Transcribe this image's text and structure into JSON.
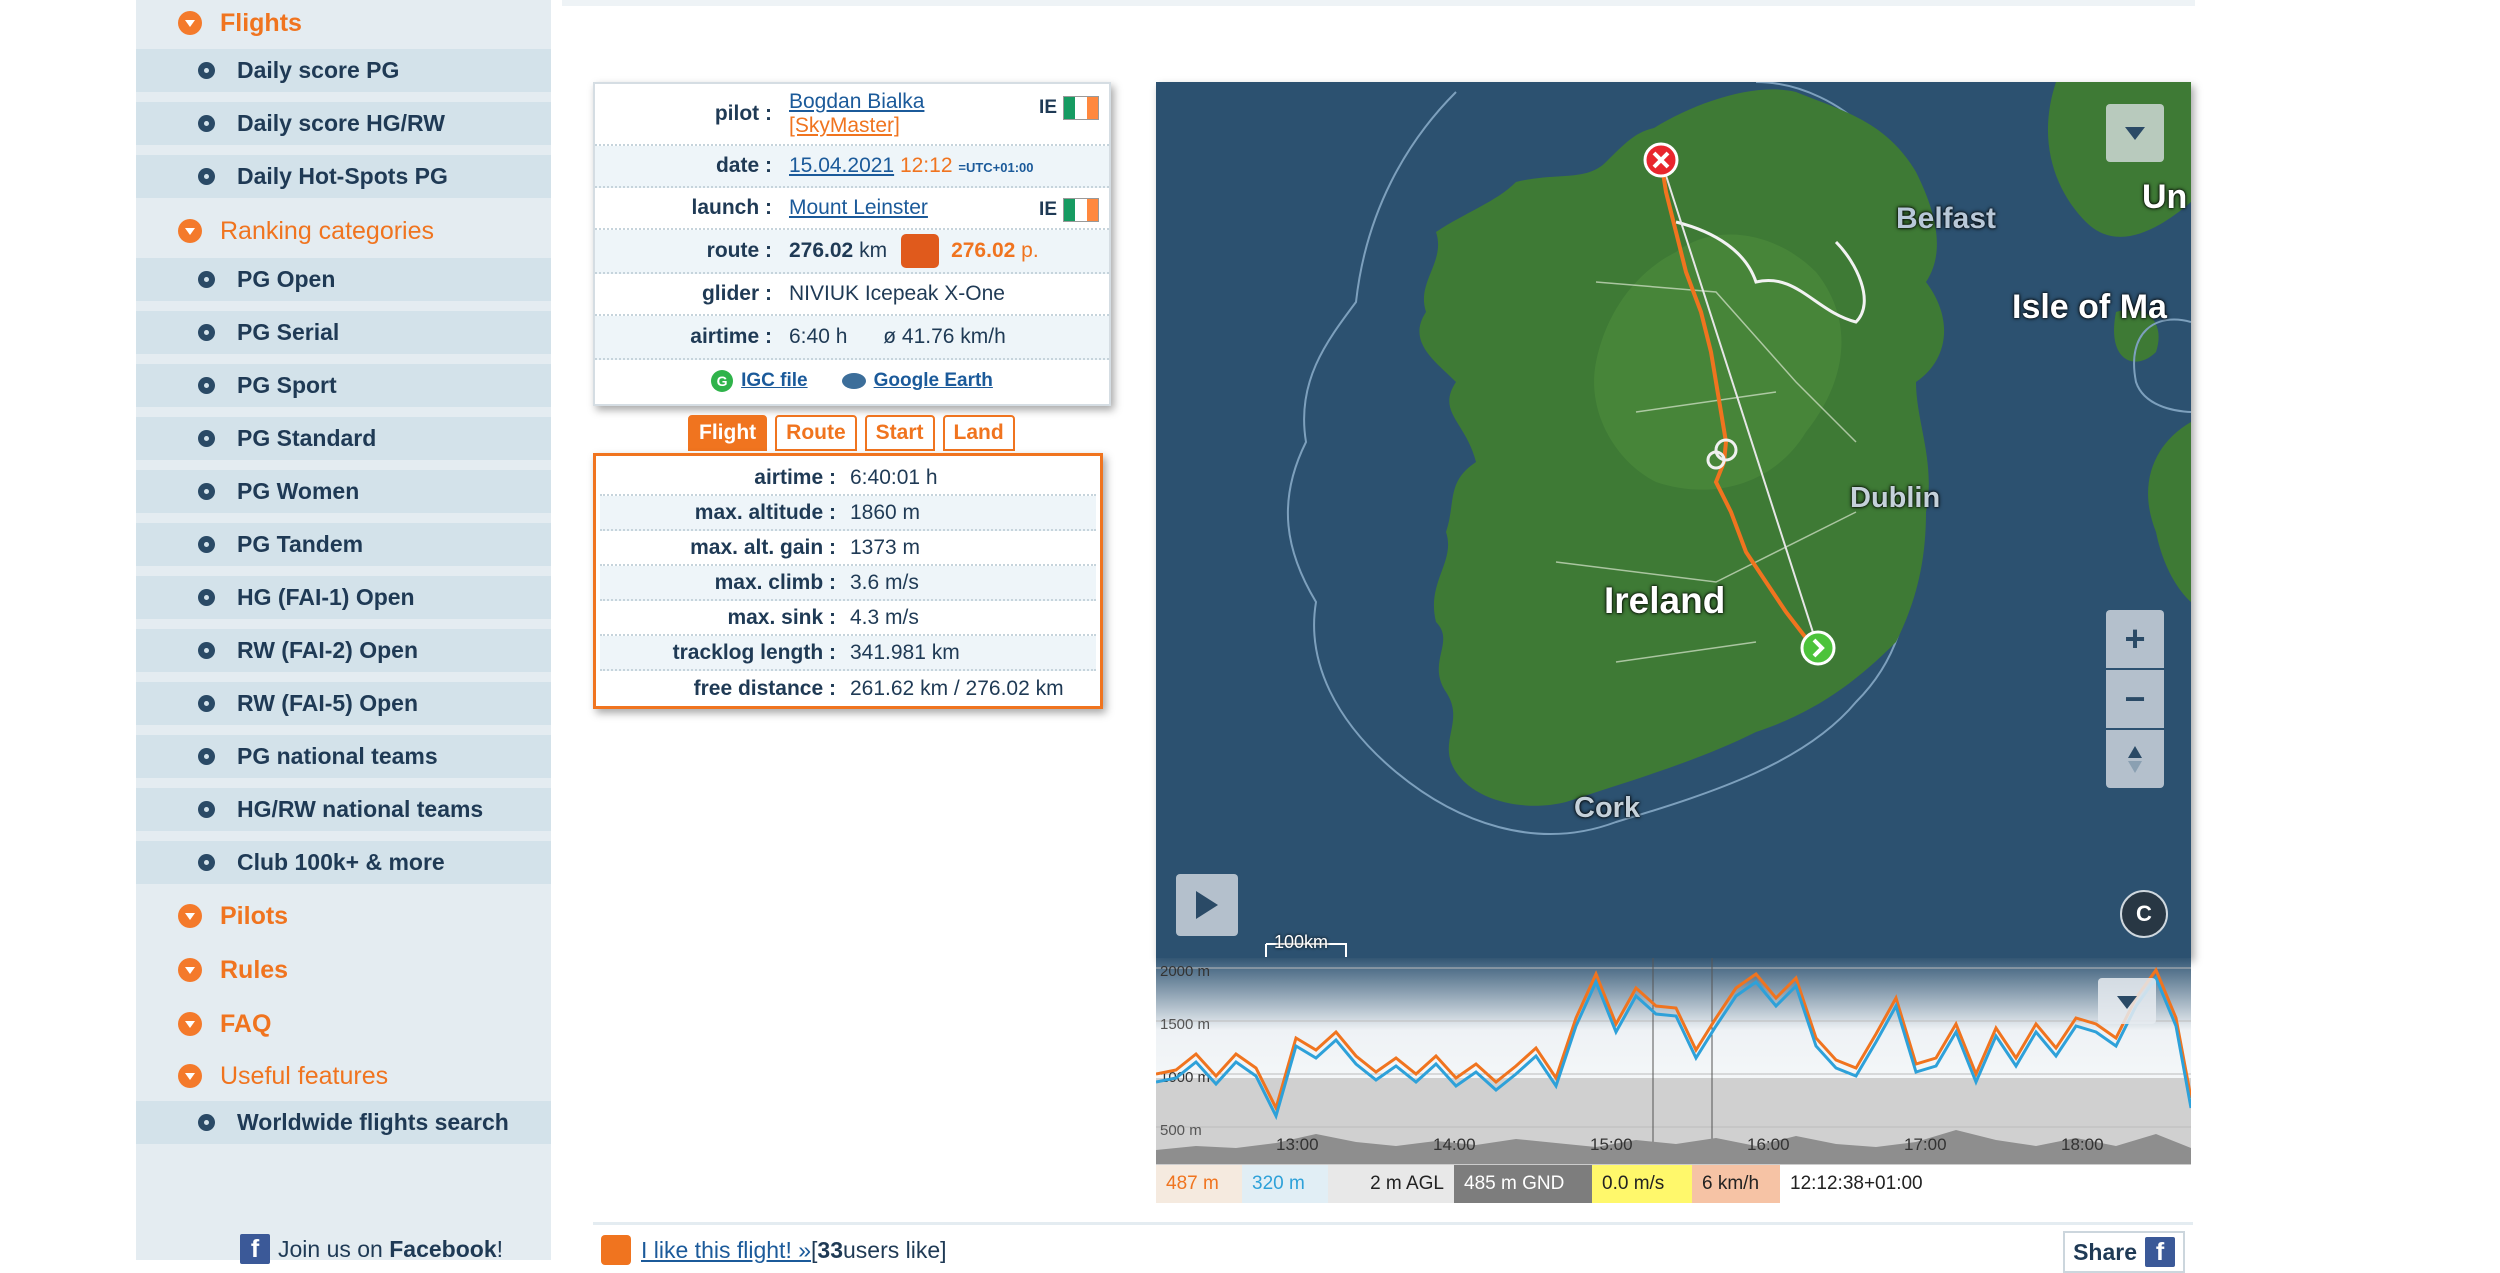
{
  "sidebar": {
    "flights": "Flights",
    "flights_items": [
      "Daily score PG",
      "Daily score HG/RW",
      "Daily Hot-Spots PG"
    ],
    "ranking": "Ranking categories",
    "ranking_items": [
      "PG Open",
      "PG Serial",
      "PG Sport",
      "PG Standard",
      "PG Women",
      "PG Tandem",
      "HG (FAI-1) Open",
      "RW (FAI-2) Open",
      "RW (FAI-5) Open",
      "PG national teams",
      "HG/RW national teams",
      "Club 100k+ & more"
    ],
    "pilots": "Pilots",
    "rules": "Rules",
    "faq": "FAQ",
    "useful": "Useful features",
    "useful_items": [
      "Worldwide flights search"
    ],
    "facebook_prefix": "Join us on ",
    "facebook_name": "Facebook",
    "facebook_suffix": "!"
  },
  "info": {
    "pilot_key": "pilot :",
    "pilot_name": "Bogdan Bialka",
    "pilot_club": "[SkyMaster]",
    "pilot_country": "IE",
    "date_key": "date :",
    "date": "15.04.2021",
    "time": "12:12",
    "tz": "=UTC+01:00",
    "launch_key": "launch :",
    "launch": "Mount Leinster",
    "launch_country": "IE",
    "route_key": "route :",
    "route_km": "276.02",
    "route_km_unit": "km",
    "route_points": "276.02",
    "route_points_unit": "p.",
    "glider_key": "glider :",
    "glider": "NIVIUK Icepeak X-One",
    "airtime_key": "airtime :",
    "airtime": "6:40 h",
    "avg_speed": "ø 41.76 km/h",
    "igc": "IGC file",
    "google_earth": "Google Earth"
  },
  "tabs": [
    "Flight",
    "Route",
    "Start",
    "Land"
  ],
  "stats": [
    {
      "key": "airtime :",
      "val": "6:40:01 h"
    },
    {
      "key": "max. altitude :",
      "val": "1860 m"
    },
    {
      "key": "max. alt. gain :",
      "val": "1373 m"
    },
    {
      "key": "max. climb :",
      "val": "3.6 m/s"
    },
    {
      "key": "max. sink :",
      "val": "4.3 m/s"
    },
    {
      "key": "tracklog length :",
      "val": "341.981 km"
    },
    {
      "key": "free distance :",
      "val": "261.62 km / 276.02 km"
    }
  ],
  "map": {
    "labels": {
      "ireland": "Ireland",
      "belfast": "Belfast",
      "dublin": "Dublin",
      "cork": "Cork",
      "isle": "Isle of Ma",
      "uk": "Un"
    },
    "scale": "100km",
    "zoom_in": "+",
    "zoom_out": "−",
    "copyright": "C"
  },
  "profile": {
    "y_labels": [
      "2000 m",
      "1500 m",
      "1000 m",
      "500 m"
    ],
    "x_labels": [
      "13:00",
      "14:00",
      "15:00",
      "16:00",
      "17:00",
      "18:00"
    ]
  },
  "status": {
    "alt_gps": "487 m",
    "alt_baro": "320 m",
    "agl": "2 m AGL",
    "gnd": "485 m GND",
    "vario": "0.0 m/s",
    "speed": "6 km/h",
    "time": "12:12:38+01:00"
  },
  "bottom": {
    "like_link": "I like this flight! »",
    "like_prefix": " [",
    "like_count": "33",
    "like_suffix": " users like]",
    "share": "Share"
  },
  "colors": {
    "accent": "#f0741f",
    "navy": "#1f3a55",
    "sidebar_bg": "#e4ecf1",
    "sub_bg": "#d3e2ea"
  }
}
